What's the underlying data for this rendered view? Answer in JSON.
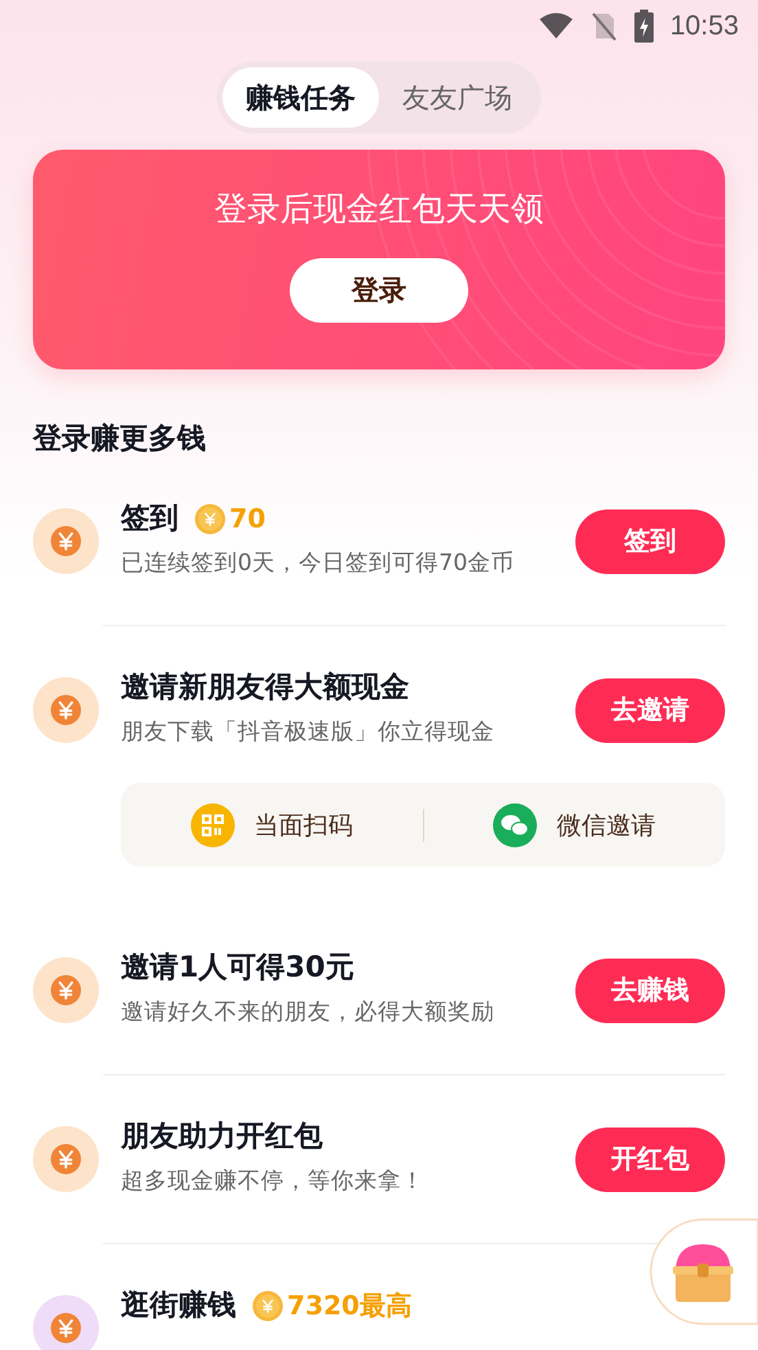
{
  "status_bar": {
    "time": "10:53"
  },
  "tabs": [
    {
      "label": "赚钱任务",
      "selected": true
    },
    {
      "label": "友友广场",
      "selected": false
    }
  ],
  "banner": {
    "title": "登录后现金红包天天领",
    "button": "登录"
  },
  "section_title": "登录赚更多钱",
  "tasks": [
    {
      "title": "签到",
      "reward": "70",
      "subtitle": "已连续签到0天，今日签到可得70金币",
      "button": "签到",
      "color": "#fde3c9"
    },
    {
      "title": "邀请新朋友得大额现金",
      "subtitle": "朋友下载「抖音极速版」你立得现金",
      "button": "去邀请",
      "color": "#fde3c9",
      "actions": [
        {
          "kind": "qr",
          "label": "当面扫码"
        },
        {
          "kind": "wechat",
          "label": "微信邀请"
        }
      ]
    },
    {
      "title": "邀请1人可得30元",
      "subtitle": "邀请好久不来的朋友，必得大额奖励",
      "button": "去赚钱",
      "color": "#fde3c9"
    },
    {
      "title": "朋友助力开红包",
      "subtitle": "超多现金赚不停，等你来拿！",
      "button": "开红包",
      "color": "#fde3c9"
    },
    {
      "title": "逛街赚钱",
      "reward": "7320最高",
      "color": "#efdcf8"
    }
  ]
}
